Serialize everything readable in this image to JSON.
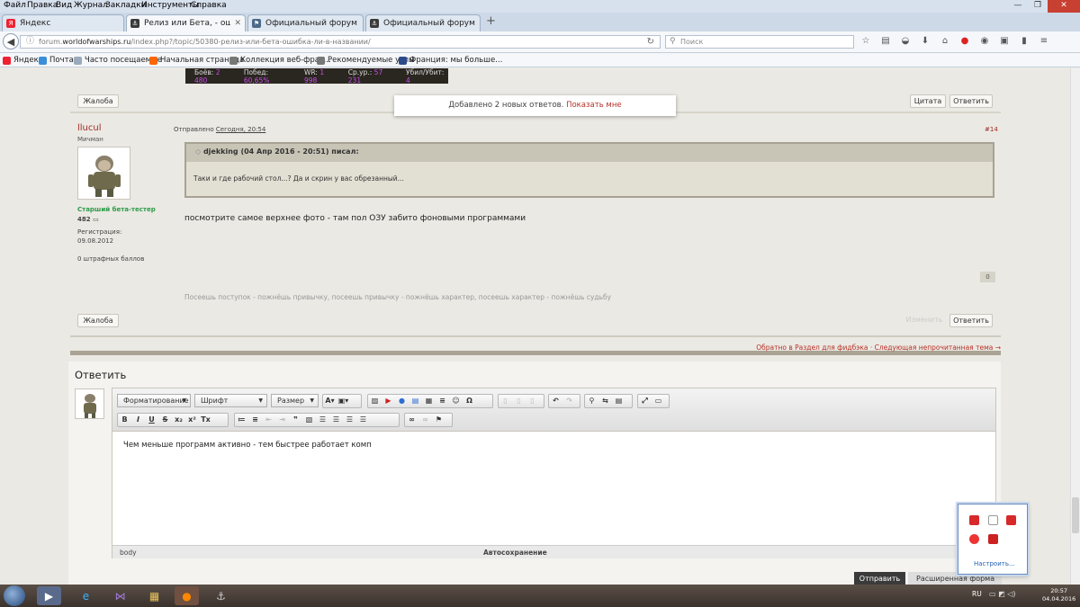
{
  "menubar": [
    "Файл",
    "Правка",
    "Вид",
    "Журнал",
    "Закладки",
    "Инструменты",
    "Справка"
  ],
  "window_controls": {
    "minimize": "—",
    "maximize": "❐",
    "close": "✕"
  },
  "tabs": [
    {
      "title": "Яндекс",
      "active": false
    },
    {
      "title": "Релиз или Бета, - ошибка...",
      "active": true
    },
    {
      "title": "Официальный форум иг...",
      "active": false
    },
    {
      "title": "Официальный форум иг...",
      "active": false
    }
  ],
  "new_tab": "+",
  "url": {
    "prefix": "forum.",
    "domain": "worldofwarships.ru",
    "path": "/index.php?/topic/50380-релиз-или-бета-ошибка-ли-в-названии/"
  },
  "search_placeholder": "Поиск",
  "bookmarks": [
    "Яндекс",
    "Почта",
    "Часто посещаемые",
    "Начальная страница",
    "Коллекция веб-фраг...",
    "Рекомендуемые узлы",
    "Франция: мы больше..."
  ],
  "signature_stats": [
    {
      "label": "Боёв:",
      "value": "2 480"
    },
    {
      "label": "Побед:",
      "value": "60,65%"
    },
    {
      "label": "WR:",
      "value": "1 998"
    },
    {
      "label": "Ср.ур.:",
      "value": "57 231"
    },
    {
      "label": "Убил/Убит:",
      "value": "4"
    }
  ],
  "post1": {
    "report": "Жалоба",
    "quote": "Цитата",
    "reply": "Ответить"
  },
  "toast": {
    "text": "Добавлено 2 новых ответов.",
    "link": "Показать мне"
  },
  "post2": {
    "username": "llucul",
    "rank": "Мичман",
    "posted_label": "Отправлено",
    "posted_time": "Сегодня, 20:54",
    "post_number": "#14",
    "group": "Старший бета-тестер",
    "post_count": "482",
    "reg_label": "Регистрация:",
    "reg_date": "09.08.2012",
    "penalty": "0 штрафных баллов",
    "quote_header": "djekking (04 Апр 2016 - 20:51) писал:",
    "quote_body": "Таки и где рабочий стол...? Да и скрин у вас обрезанный...",
    "text": "посмотрите самое верхнее фото - там пол ОЗУ забито фоновыми программами",
    "rep": "0",
    "signature": "Посеешь поступок - пожнёшь привычку, посеешь привычку - пожнёшь характер, посеешь характер - пожнёшь судьбу",
    "report": "Жалоба",
    "edit": "Изменить",
    "reply": "Ответить"
  },
  "bottom_links": "Обратно в Раздел для фидбэка · Следующая непрочитанная тема →",
  "reply_box": {
    "title": "Ответить",
    "format": "Форматирование",
    "font": "Шрифт",
    "size": "Размер",
    "content": "Чем меньше программ активно - тем быстрее работает комп",
    "path": "body",
    "autosave": "Автосохранение",
    "send": "Отправить",
    "advanced": "Расширенная форма"
  },
  "tray_popup": {
    "configure": "Настроить..."
  },
  "taskbar": {
    "lang": "RU",
    "time": "20:57",
    "date": "04.04.2016"
  }
}
